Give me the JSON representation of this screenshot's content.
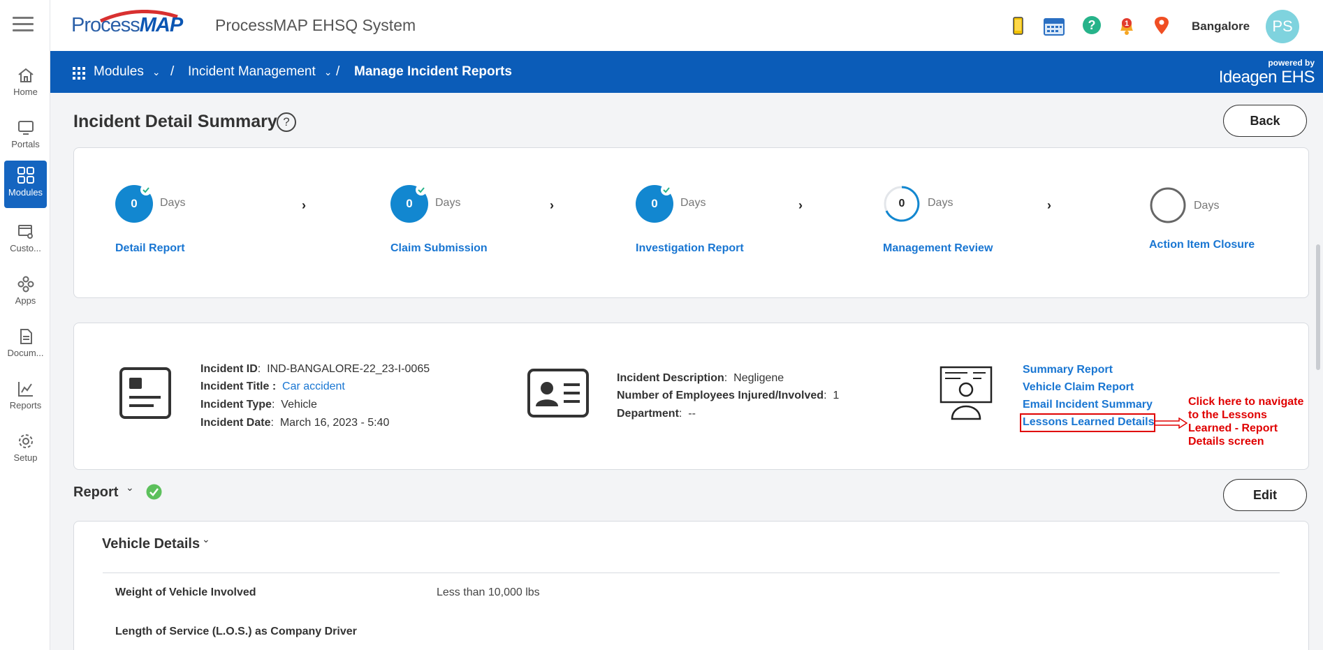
{
  "header": {
    "logo_text_a": "Process",
    "logo_text_b": "MAP",
    "app_title": "ProcessMAP EHSQ System",
    "location": "Bangalore",
    "avatar_initials": "PS",
    "icons": [
      "mobile-icon",
      "calendar-icon",
      "help-icon",
      "notification-bell-icon",
      "location-pin-icon"
    ],
    "notification_count": "1"
  },
  "sidebar": {
    "items": [
      {
        "label": "Home",
        "icon": "home-icon"
      },
      {
        "label": "Portals",
        "icon": "monitor-icon"
      },
      {
        "label": "Modules",
        "icon": "grid-icon",
        "active": true
      },
      {
        "label": "Custo...",
        "icon": "customize-icon"
      },
      {
        "label": "Apps",
        "icon": "apps-icon"
      },
      {
        "label": "Docum...",
        "icon": "document-icon"
      },
      {
        "label": "Reports",
        "icon": "reports-icon"
      },
      {
        "label": "Setup",
        "icon": "gear-icon"
      }
    ]
  },
  "breadcrumb": {
    "modules": "Modules",
    "incident_management": "Incident Management",
    "current": "Manage Incident Reports",
    "separator": "/",
    "powered_by": "powered by",
    "brand": "Ideagen EHS"
  },
  "page": {
    "title": "Incident Detail Summary",
    "help": "?",
    "back_label": "Back",
    "edit_label": "Edit"
  },
  "steps": [
    {
      "count": "0",
      "days": "Days",
      "label": "Detail Report",
      "state": "complete"
    },
    {
      "count": "0",
      "days": "Days",
      "label": "Claim Submission",
      "state": "complete"
    },
    {
      "count": "0",
      "days": "Days",
      "label": "Investigation Report",
      "state": "complete"
    },
    {
      "count": "0",
      "days": "Days",
      "label": "Management Review",
      "state": "in-progress"
    },
    {
      "count": "",
      "days": "Days",
      "label": "Action Item Closure",
      "state": "pending"
    }
  ],
  "incident": {
    "id_label": "Incident ID",
    "id_value": "IND-BANGALORE-22_23-I-0065",
    "title_label": "Incident Title :",
    "title_value": "Car accident",
    "type_label": "Incident Type",
    "type_value": "Vehicle",
    "date_label": "Incident Date",
    "date_value": "March 16, 2023 - 5:40",
    "desc_label": "Incident Description",
    "desc_value": "Negligene",
    "employees_label": "Number of Employees Injured/Involved",
    "employees_value": "1",
    "dept_label": "Department",
    "dept_value": "--"
  },
  "report_links": {
    "summary": "Summary Report",
    "vehicle_claim": "Vehicle Claim Report",
    "email_summary": "Email Incident Summary",
    "lessons_learned": "Lessons Learned Details"
  },
  "annotation": {
    "text": "Click here to navigate to the Lessons Learned - Report Details screen"
  },
  "report_section": {
    "title": "Report",
    "vehicle_details_title": "Vehicle Details",
    "fields": [
      {
        "label": "Weight of Vehicle Involved",
        "value": "Less than 10,000 lbs"
      },
      {
        "label": "Length of Service (L.O.S.) as Company Driver",
        "value": ""
      }
    ]
  },
  "colors": {
    "primary": "#0b5cb8",
    "link": "#1976d2",
    "step": "#1287d0",
    "success": "#5cc05c",
    "annotation": "#e00000"
  }
}
